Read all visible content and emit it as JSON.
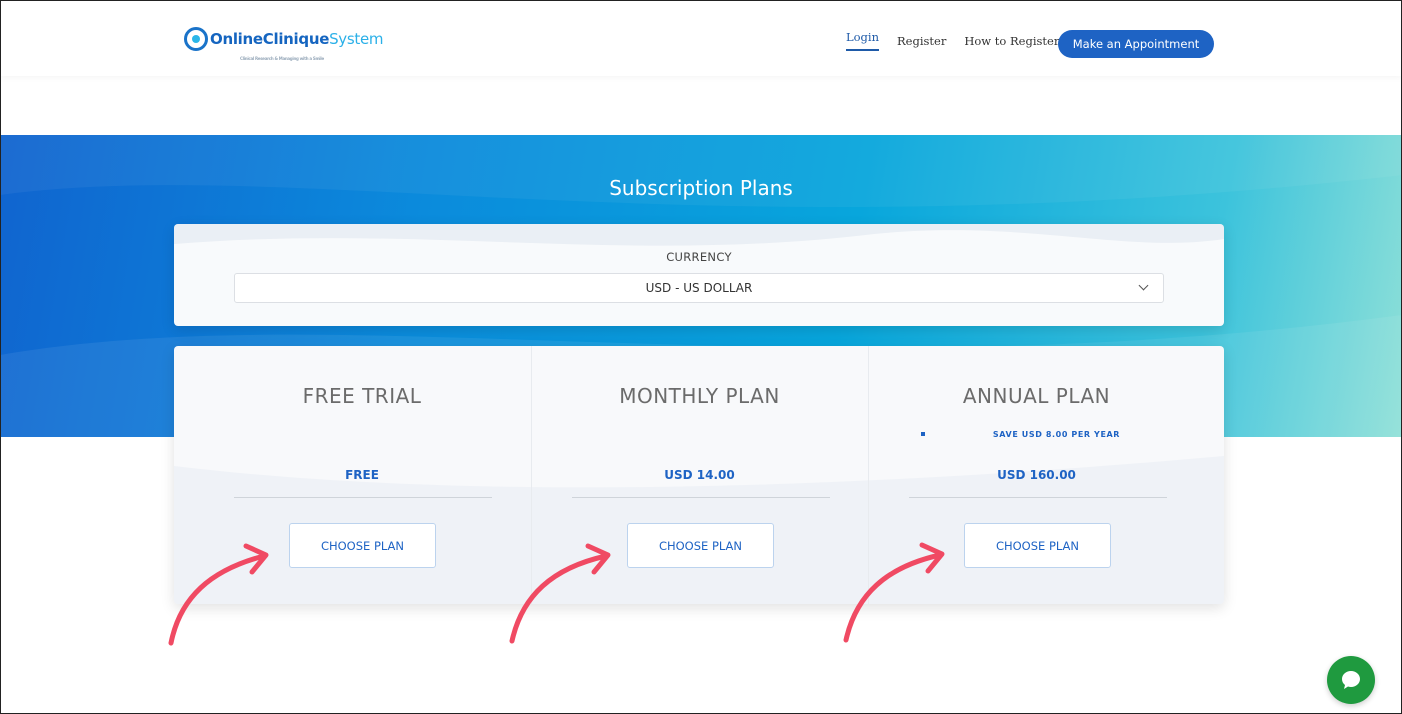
{
  "header": {
    "logo": {
      "strong": "Online",
      "mid": "Clinique",
      "light": "System",
      "tagline": "Clinical Research & Managing with a Smile"
    },
    "nav": [
      {
        "label": "Login",
        "active": true
      },
      {
        "label": "Register",
        "active": false
      },
      {
        "label": "How to Register",
        "active": false
      }
    ],
    "cta_label": "Make an Appointment"
  },
  "hero": {
    "title": "Subscription Plans"
  },
  "currency": {
    "label": "CURRENCY",
    "selected": "USD - US DOLLAR"
  },
  "plans": [
    {
      "title": "FREE TRIAL",
      "save": "",
      "price": "FREE",
      "button": "CHOOSE PLAN"
    },
    {
      "title": "MONTHLY PLAN",
      "save": "",
      "price": "USD 14.00",
      "button": "CHOOSE PLAN"
    },
    {
      "title": "ANNUAL PLAN",
      "save": "SAVE USD 8.00 PER YEAR",
      "price": "USD 160.00",
      "button": "CHOOSE PLAN"
    }
  ],
  "colors": {
    "primary": "#1e63c4",
    "arrow": "#f04a63",
    "chat": "#1f9a3f"
  },
  "icons": {
    "chat": "chat-bubble-icon",
    "dropdown": "chevron-down-icon",
    "annotation": "arrow-annotation-icon"
  }
}
